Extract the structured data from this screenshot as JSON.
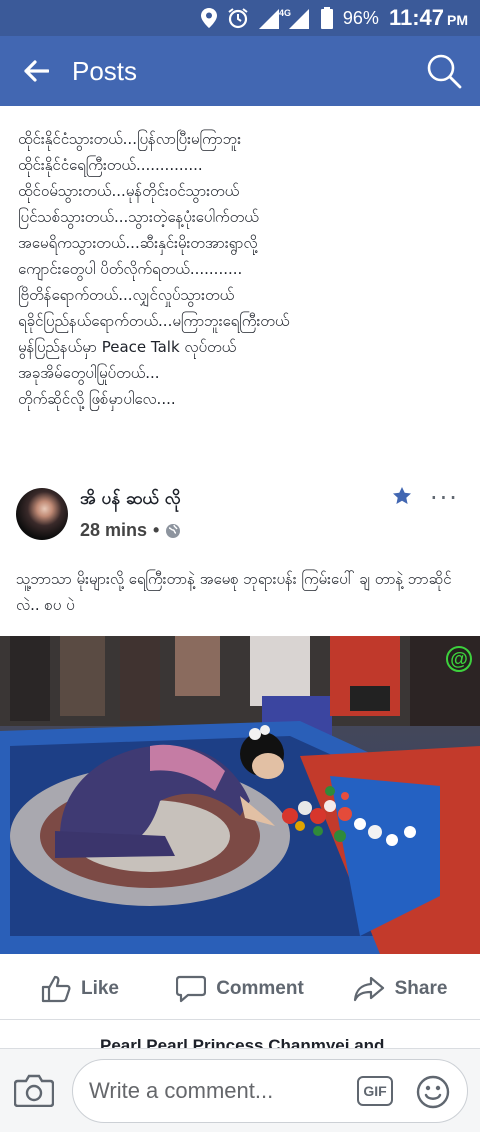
{
  "status_bar": {
    "network": "4G",
    "battery": "96%",
    "time": "11:47",
    "ampm": "PM"
  },
  "header": {
    "title": "Posts"
  },
  "post": {
    "lines": [
      "ထိုင်းနိုင်ငံသွားတယ်...ပြန်လာပြီးမကြာဘူး",
      "ထိုင်းနိုင်ငံရေကြီးတယ်..............",
      "ထိုင်ဝမ်သွားတယ်...မုန်တိုင်းဝင်သွားတယ်",
      "ပြင်သစ်သွားတယ်...သွားတဲ့နေ့ပုံးပေါက်တယ်",
      "အမေရိကသွားတယ်...ဆီးနှင်းမိုးတအားရွာလို့",
      "ကျောင်းတွေပါ ပိတ်လိုက်ရတယ်...........",
      "ဗြိတိန်ရောက်တယ်...လျှင်လှုပ်သွားတယ်",
      "ရခိုင်ပြည်နယ်ရောက်တယ်...မကြာဘူးရေကြီးတယ်",
      "မွန်ပြည်နယ်မှာ Peace Talk လုပ်တယ်",
      "အခုအိမ်တွေပါမြုပ်တယ်...",
      "တိုက်ဆိုင်လို့ ဖြစ်မှာပါလေ...."
    ]
  },
  "shared_post": {
    "author": "အိ ပန် ဆယ် လို",
    "time": "28 mins",
    "caption": "သူ့ဘာသာ မိုးများလို့ ရေကြီးတာနဲ့ အမေစု ဘုရားပန်း ကြမ်းပေါ် ချ တာနဲ့ ဘာဆိုင်လဲ.. စပ ပဲ",
    "image_badge": "@"
  },
  "actions": {
    "like": "Like",
    "comment": "Comment",
    "share": "Share"
  },
  "next_comment_author": "Pearl Pearl Princess Chanmyei and",
  "composer": {
    "placeholder": "Write a comment...",
    "gif": "GIF"
  },
  "colors": {
    "status_bar": "#3b5a99",
    "app_bar": "#4267b2",
    "star": "#4267b2",
    "action_gray": "#606770"
  }
}
